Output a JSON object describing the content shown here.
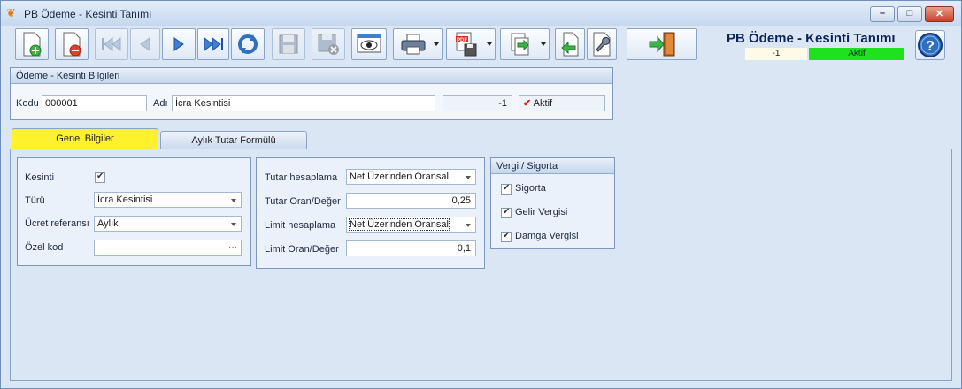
{
  "window": {
    "title": "PB Ödeme - Kesinti Tanımı",
    "controls": {
      "minimize": "–",
      "maximize": "□",
      "close": "✕"
    }
  },
  "toolbar": {
    "buttons": [
      {
        "name": "new-record",
        "icon": "new-document-icon",
        "enabled": true
      },
      {
        "name": "delete-record",
        "icon": "delete-document-icon",
        "enabled": true
      },
      {
        "name": "first-record",
        "icon": "first-record-icon",
        "enabled": false
      },
      {
        "name": "previous-record",
        "icon": "previous-record-icon",
        "enabled": false
      },
      {
        "name": "next-record",
        "icon": "next-record-icon",
        "enabled": true
      },
      {
        "name": "last-record",
        "icon": "last-record-icon",
        "enabled": true
      },
      {
        "name": "refresh",
        "icon": "refresh-icon",
        "enabled": true
      },
      {
        "name": "save",
        "icon": "save-icon",
        "enabled": false
      },
      {
        "name": "cancel-save",
        "icon": "save-cancel-icon",
        "enabled": false
      },
      {
        "name": "preview",
        "icon": "preview-eye-icon",
        "enabled": true
      },
      {
        "name": "print",
        "icon": "printer-icon",
        "enabled": true
      },
      {
        "name": "export-pdf",
        "icon": "pdf-save-icon",
        "enabled": true
      },
      {
        "name": "export",
        "icon": "export-icon",
        "enabled": true
      },
      {
        "name": "import",
        "icon": "import-icon",
        "enabled": true
      },
      {
        "name": "tools",
        "icon": "wrench-icon",
        "enabled": true
      },
      {
        "name": "exit",
        "icon": "exit-door-icon",
        "enabled": true
      }
    ]
  },
  "header": {
    "title": "PB Ödeme - Kesinti Tanımı",
    "record_number": "-1",
    "status": "Aktif",
    "status_color": "#1fe21f"
  },
  "info_group": {
    "caption": "Ödeme - Kesinti Bilgileri",
    "code_label": "Kodu",
    "code_value": "000001",
    "name_label": "Adı",
    "name_value": "İcra Kesintisi",
    "number_value": "-1",
    "active_label": "Aktif",
    "active_checked": true
  },
  "tabs": [
    {
      "label": "Genel Bilgiler",
      "active": true,
      "active_color": "#fff22c"
    },
    {
      "label": "Aylık Tutar Formülü",
      "active": false
    }
  ],
  "general": {
    "kesinti_label": "Kesinti",
    "kesinti_checked": true,
    "type_label": "Türü",
    "type_value": "İcra Kesintisi",
    "wage_ref_label": "Ücret referansı",
    "wage_ref_value": "Aylık",
    "special_code_label": "Özel kod",
    "special_code_value": ""
  },
  "calc": {
    "amount_calc_label": "Tutar hesaplama",
    "amount_calc_value": "Net Üzerinden Oransal",
    "amount_rate_label": "Tutar Oran/Değer",
    "amount_rate_value": "0,25",
    "limit_calc_label": "Limit hesaplama",
    "limit_calc_value": "Net Üzerinden Oransal",
    "limit_rate_label": "Limit Oran/Değer",
    "limit_rate_value": "0,1"
  },
  "tax": {
    "caption": "Vergi / Sigorta",
    "items": [
      {
        "label": "Sigorta",
        "checked": true
      },
      {
        "label": "Gelir Vergisi",
        "checked": true
      },
      {
        "label": "Damga Vergisi",
        "checked": true
      }
    ]
  }
}
